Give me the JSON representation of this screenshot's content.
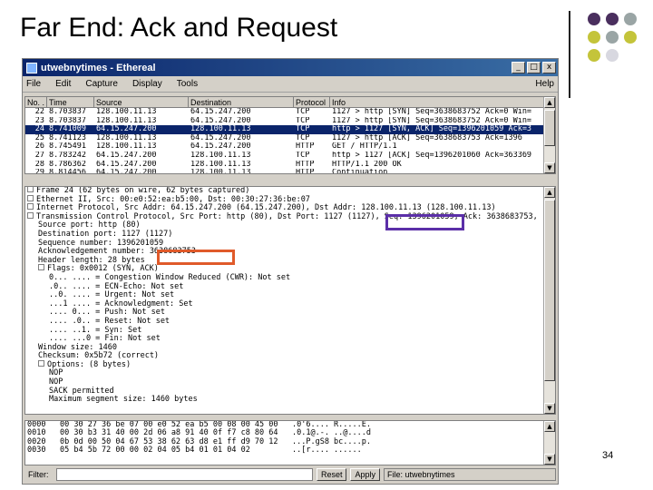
{
  "slide": {
    "title": "Far End: Ack and Request",
    "page_number": "34",
    "dot_colors": [
      "#4a2f5e",
      "#4a2f5e",
      "#9aa5a5",
      "#c4c43a",
      "#9aa5a5",
      "#c4c43a",
      "#c4c43a",
      "#d8d8e0"
    ]
  },
  "window": {
    "title": "utwebnytimes - Ethereal",
    "minimize_label": "_",
    "maximize_label": "□",
    "close_label": "x",
    "menu": [
      "File",
      "Edit",
      "Capture",
      "Display",
      "Tools"
    ],
    "menu_help": "Help"
  },
  "packet_list": {
    "columns": [
      "No. .",
      "Time",
      "Source",
      "Destination",
      "Protocol",
      "Info"
    ],
    "rows": [
      {
        "no": "22",
        "time": "8.703837",
        "src": "128.100.11.13",
        "dst": "64.15.247.200",
        "proto": "TCP",
        "info": "1127 > http [SYN] Seq=3638683752 Ack=0 Win=",
        "selected": false
      },
      {
        "no": "23",
        "time": "8.703837",
        "src": "128.100.11.13",
        "dst": "64.15.247.200",
        "proto": "TCP",
        "info": "1127 > http [SYN] Seq=3638683752 Ack=0 Win=",
        "selected": false
      },
      {
        "no": "24",
        "time": "8.741009",
        "src": "64.15.247.200",
        "dst": "128.100.11.13",
        "proto": "TCP",
        "info": "http > 1127 [SYN, ACK] Seq=1396201059 Ack=3",
        "selected": true
      },
      {
        "no": "25",
        "time": "8.741123",
        "src": "128.100.11.13",
        "dst": "64.15.247.200",
        "proto": "TCP",
        "info": "1127 > http [ACK] Seq=3638683753 Ack=1396",
        "selected": false
      },
      {
        "no": "26",
        "time": "8.745491",
        "src": "128.100.11.13",
        "dst": "64.15.247.200",
        "proto": "HTTP",
        "info": "GET / HTTP/1.1",
        "selected": false
      },
      {
        "no": "27",
        "time": "8.783242",
        "src": "64.15.247.200",
        "dst": "128.100.11.13",
        "proto": "TCP",
        "info": "http > 1127 [ACK] Seq=1396201060 Ack=363369",
        "selected": false
      },
      {
        "no": "28",
        "time": "8.786362",
        "src": "64.15.247.200",
        "dst": "128.100.11.13",
        "proto": "HTTP",
        "info": "HTTP/1.1 200 OK",
        "selected": false
      },
      {
        "no": "29",
        "time": "8.814456",
        "src": "64.15.247.200",
        "dst": "128.100.11.13",
        "proto": "HTTP",
        "info": "Continuation",
        "selected": false
      }
    ]
  },
  "details": [
    {
      "indent": 0,
      "toggle": true,
      "text": "Frame 24 (62 bytes on wire, 62 bytes captured)"
    },
    {
      "indent": 0,
      "toggle": true,
      "text": "Ethernet II, Src: 00:e0:52:ea:b5:00, Dst: 00:30:27:36:be:07"
    },
    {
      "indent": 0,
      "toggle": true,
      "text": "Internet Protocol, Src Addr: 64.15.247.200 (64.15.247.200), Dst Addr: 128.100.11.13 (128.100.11.13)"
    },
    {
      "indent": 0,
      "toggle": true,
      "text": "Transmission Control Protocol, Src Port: http (80), Dst Port: 1127 (1127), Seq: 1396201059, Ack: 3638683753,"
    },
    {
      "indent": 1,
      "toggle": false,
      "text": "Source port: http (80)"
    },
    {
      "indent": 1,
      "toggle": false,
      "text": "Destination port: 1127 (1127)"
    },
    {
      "indent": 1,
      "toggle": false,
      "text": "Sequence number: 1396201059"
    },
    {
      "indent": 1,
      "toggle": false,
      "text": "Acknowledgement number: 3638683753"
    },
    {
      "indent": 1,
      "toggle": false,
      "text": "Header length: 28 bytes"
    },
    {
      "indent": 1,
      "toggle": true,
      "text": "Flags: 0x0012 (SYN, ACK)"
    },
    {
      "indent": 2,
      "toggle": false,
      "text": "0... .... = Congestion Window Reduced (CWR): Not set"
    },
    {
      "indent": 2,
      "toggle": false,
      "text": ".0.. .... = ECN-Echo: Not set"
    },
    {
      "indent": 2,
      "toggle": false,
      "text": "..0. .... = Urgent: Not set"
    },
    {
      "indent": 2,
      "toggle": false,
      "text": "...1 .... = Acknowledgment: Set"
    },
    {
      "indent": 2,
      "toggle": false,
      "text": ".... 0... = Push: Not set"
    },
    {
      "indent": 2,
      "toggle": false,
      "text": ".... .0.. = Reset: Not set"
    },
    {
      "indent": 2,
      "toggle": false,
      "text": ".... ..1. = Syn: Set"
    },
    {
      "indent": 2,
      "toggle": false,
      "text": ".... ...0 = Fin: Not set"
    },
    {
      "indent": 1,
      "toggle": false,
      "text": "Window size: 1460"
    },
    {
      "indent": 1,
      "toggle": false,
      "text": "Checksum: 0x5b72 (correct)"
    },
    {
      "indent": 1,
      "toggle": true,
      "text": "Options: (8 bytes)"
    },
    {
      "indent": 2,
      "toggle": false,
      "text": "NOP"
    },
    {
      "indent": 2,
      "toggle": false,
      "text": "NOP"
    },
    {
      "indent": 2,
      "toggle": false,
      "text": "SACK permitted"
    },
    {
      "indent": 2,
      "toggle": false,
      "text": "Maximum segment size: 1460 bytes"
    }
  ],
  "hex": [
    {
      "off": "0000",
      "bytes": "00 30 27 36 be 07 00 e0  52 ea b5 00 08 00 45 00",
      "ascii": ".0'6.... R.....E."
    },
    {
      "off": "0010",
      "bytes": "00 30 b3 31 40 00 2d 06  a8 91 40 0f f7 c8 80 64",
      "ascii": ".0.1@.-. ..@....d"
    },
    {
      "off": "0020",
      "bytes": "0b 0d 00 50 04 67 53 38  62 63 d8 e1 ff d9 70 12",
      "ascii": "...P.gS8 bc....p."
    },
    {
      "off": "0030",
      "bytes": "05 b4 5b 72 00 00 02 04  05 b4 01 01 04 02",
      "ascii": "..[r.... ......"
    }
  ],
  "status": {
    "filter_label": "Filter:",
    "reset_label": "Reset",
    "apply_label": "Apply",
    "file_label": "File: utwebnytimes"
  }
}
